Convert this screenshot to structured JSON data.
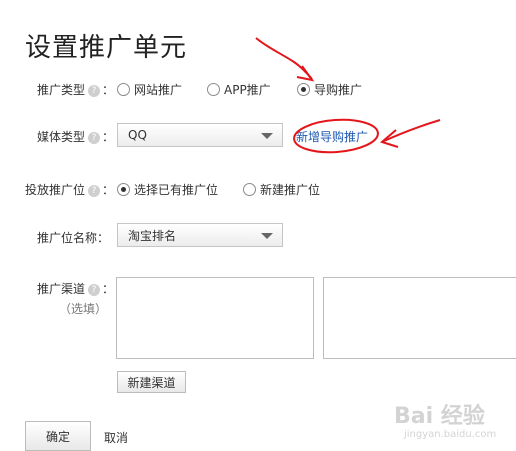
{
  "page": {
    "title": "设置推广单元"
  },
  "form": {
    "promo_type": {
      "label": "推广类型",
      "options": [
        "网站推广",
        "APP推广",
        "导购推广"
      ],
      "selected_index": 2
    },
    "media_type": {
      "label": "媒体类型",
      "value": "QQ",
      "add_link": "新增导购推广"
    },
    "placement": {
      "label": "投放推广位",
      "options": [
        "选择已有推广位",
        "新建推广位"
      ],
      "selected_index": 0
    },
    "placement_name": {
      "label": "推广位名称",
      "value": "淘宝排名"
    },
    "channel": {
      "label": "推广渠道",
      "optional": "（选填）",
      "new_button": "新建渠道"
    },
    "help_glyph": "?",
    "colon": "："
  },
  "actions": {
    "confirm": "确定",
    "cancel": "取消"
  },
  "watermark": {
    "text": "Bai 经验",
    "url": "jingyan.baidu.com"
  },
  "colors": {
    "link": "#1d58b1",
    "annotation": "#e3161b"
  }
}
